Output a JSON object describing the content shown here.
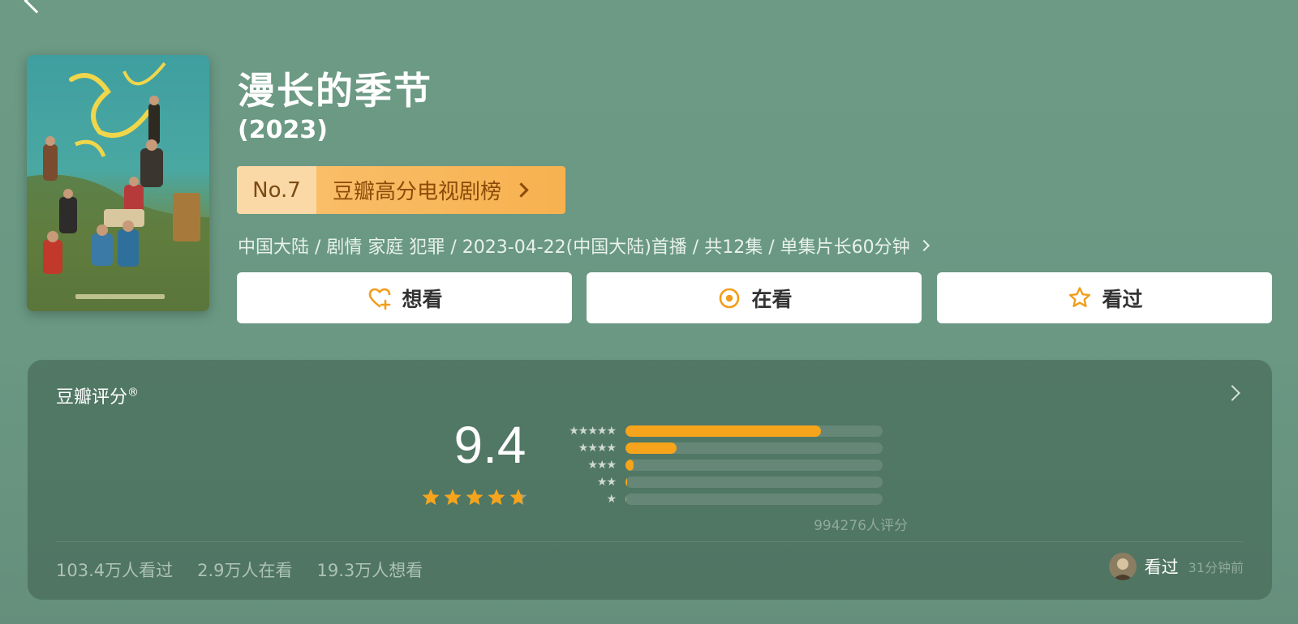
{
  "show": {
    "title": "漫长的季节",
    "year": "(2023)",
    "rank": {
      "no": "No.7",
      "list": "豆瓣高分电视剧榜"
    },
    "meta": "中国大陆 / 剧情 家庭 犯罪 / 2023-04-22(中国大陆)首播 / 共12集 / 单集片长60分钟"
  },
  "actions": {
    "want": "想看",
    "watching": "在看",
    "watched": "看过"
  },
  "rating": {
    "title": "豆瓣评分",
    "mark": "®",
    "score": "9.4",
    "stars_value": 4.7,
    "count": "994276人评分",
    "distribution": [
      {
        "stars": "★★★★★",
        "percent": 76
      },
      {
        "stars": "★★★★",
        "percent": 20
      },
      {
        "stars": "★★★",
        "percent": 3
      },
      {
        "stars": "★★",
        "percent": 0.5
      },
      {
        "stars": "★",
        "percent": 0.3
      }
    ],
    "stats": {
      "watched": "103.4万人看过",
      "watching": "2.9万人在看",
      "want": "19.3万人想看"
    },
    "friend": {
      "status": "看过",
      "time": "31分钟前"
    }
  },
  "colors": {
    "accent": "#f6a41b",
    "background": "#6c9a85"
  }
}
